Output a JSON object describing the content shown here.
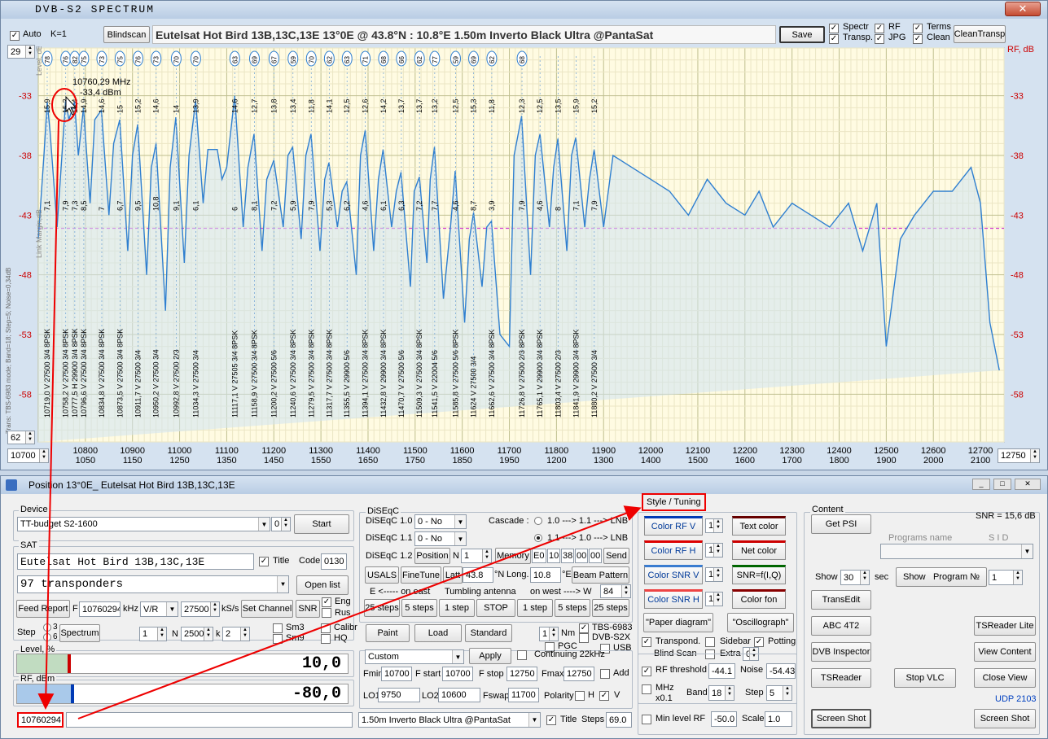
{
  "spectrum": {
    "title": "DVB-S2   SPECTRUM",
    "auto_label": "Auto",
    "k_label": "K=1",
    "blindscan_label": "Blindscan",
    "satellite_info": "Eutelsat Hot Bird 13B,13C,13E    13°0E  @ 43.8°N : 10.8°E     1.50m  Inverto Black Ultra @PantaSat",
    "save_label": "Save",
    "checks": [
      "Spectr",
      "Transp.",
      "RF",
      "JPG",
      "Terms",
      "Clean"
    ],
    "clean_transp_label": "CleanTransp",
    "top_level_value": "29",
    "bottom_level_value": "62",
    "left_freq_value": "10700",
    "right_freq_value": "12750",
    "rf_label": "RF, dB",
    "left_axis_title": "Level, dB",
    "vertical_info": "Trans:  TBS-6983 mode; Band=18; Step=5; Noise=0,34dB",
    "link_margin_label": "Link Margin,dB",
    "cursor_freq": "10760,29 MHz",
    "cursor_level": "-33,4 dBm",
    "y_ticks": [
      "-33",
      "-38",
      "-43",
      "-48",
      "-53",
      "-58"
    ],
    "x_ticks_top": [
      "10800",
      "10900",
      "11000",
      "11100",
      "11200",
      "11300",
      "11400",
      "11500",
      "11600",
      "11700",
      "11800",
      "11900",
      "12000",
      "12100",
      "12200",
      "12300",
      "12400",
      "12500",
      "12600",
      "12700"
    ],
    "x_ticks_bottom": [
      "1050",
      "1150",
      "1250",
      "1350",
      "1450",
      "1550",
      "1650",
      "1750",
      "1850",
      "1950",
      "1200",
      "1300",
      "1400",
      "1500",
      "1600",
      "1700",
      "1800",
      "1900",
      "2000",
      "2100"
    ],
    "circle_labels": [
      "78",
      "76",
      "82",
      "75",
      "73",
      "75",
      "76",
      "73",
      "70",
      "70",
      "63",
      "69",
      "67",
      "59",
      "70",
      "62",
      "63",
      "71",
      "68",
      "66",
      "62",
      "77",
      "59",
      "69",
      "62",
      "68"
    ],
    "snr_labels": [
      "15,9",
      "15,2",
      "16,4",
      "14,9",
      "14,6",
      "15",
      "15,2",
      "14,6",
      "14",
      "13,9",
      "14,6",
      "12,7",
      "13,8",
      "13,4",
      "11,8",
      "14,1",
      "12,5",
      "12,6",
      "14,2",
      "13,7",
      "13,7",
      "13,2",
      "12,5",
      "15,3",
      "11,8",
      "12,3",
      "12,5",
      "13,5"
    ],
    "margin_labels": [
      "7,1",
      "7,9",
      "7,3",
      "8,5",
      "7",
      "6,7",
      "9,5",
      "10,8",
      "9,1",
      "6,1",
      "6",
      "8,1",
      "7,2",
      "5,9",
      "7,9",
      "5,3",
      "6,2",
      "4,6",
      "6,1",
      "6,3",
      "7,2",
      "7,7",
      "4,6",
      "8,7",
      "3,9",
      "7,9",
      "4,6",
      "8"
    ],
    "transponder_labels": [
      "10719,0 V 27500 3/4 8PSK",
      "10758,2 V 27500 3/4 8PSK",
      "10777,5 H 29900 3/4 8PSK",
      "10796,6 V 27500 3/4 8PSK",
      "10834,8 V 27500 3/4 8PSK",
      "10873,5 V 27500 3/4 8PSK",
      "10911,7 V 27500 3/4",
      "10950,2 V 27500 3/4",
      "10992,8 V 27500 2/3",
      "11034,3 V 27500 3/4",
      "11117,1 V 27505 3/4 8PSK",
      "11158,9 V 27500 3/4 8PSK",
      "11200,2 V 27500 5/6",
      "11240,6 V 27500 3/4 8PSK",
      "11279,5 V 27500 3/4 8PSK",
      "11317,7 V 27500 3/4 8PSK",
      "11355,5 V 29900 5/6",
      "11394,1 V 27500 3/4 8PSK",
      "11432,8 V 29900 3/4 8PSK",
      "11470,7 V 27500 5/6",
      "11509,3 V 27500 3/4 8PSK",
      "11541,5 V 22004 5/6",
      "11585,8 V 27500 5/6 8PSK",
      "11624 V 27500 3/4",
      "11662,6 V 27500 3/4 8PSK",
      "11726,8 V 27500 2/3 8PSK",
      "11765,1 V 29900 3/4 8PSK",
      "11803,4 V 27500 2/3",
      "11841,9 V 29900 3/4 8PSK",
      "11880,2 V 27500 3/4"
    ]
  },
  "chart_data": {
    "type": "line",
    "title": "",
    "xlabel": "",
    "ylabel": "Level, dB",
    "xlim": [
      10700,
      12750
    ],
    "ylim": [
      -62,
      -29
    ],
    "threshold": -44.1,
    "x": [
      10700,
      10712,
      10719,
      10725,
      10740,
      10758,
      10765,
      10777,
      10785,
      10796,
      10810,
      10820,
      10834,
      10850,
      10860,
      10873,
      10890,
      10900,
      10911,
      10930,
      10940,
      10950,
      10970,
      10980,
      10992,
      11010,
      11020,
      11034,
      11050,
      11060,
      11080,
      11090,
      11100,
      11117,
      11135,
      11145,
      11158,
      11175,
      11185,
      11200,
      11220,
      11230,
      11240,
      11258,
      11268,
      11279,
      11298,
      11308,
      11317,
      11335,
      11345,
      11355,
      11375,
      11384,
      11394,
      11412,
      11422,
      11432,
      11450,
      11460,
      11470,
      11490,
      11498,
      11509,
      11525,
      11532,
      11541,
      11560,
      11575,
      11585,
      11605,
      11615,
      11624,
      11642,
      11652,
      11662,
      11680,
      11700,
      11710,
      11726,
      11745,
      11755,
      11765,
      11785,
      11794,
      11803,
      11822,
      11832,
      11841,
      11860,
      11870,
      11880,
      11900,
      11920,
      11960,
      12000,
      12040,
      12080,
      12120,
      12160,
      12200,
      12230,
      12260,
      12300,
      12340,
      12380,
      12420,
      12450,
      12480,
      12500,
      12530,
      12560,
      12600,
      12640,
      12680,
      12700,
      12720,
      12740,
      12750
    ],
    "y": [
      -45,
      -38,
      -33.5,
      -36,
      -44,
      -33.4,
      -35,
      -33.5,
      -38,
      -34,
      -42,
      -35,
      -34.2,
      -43,
      -37,
      -35,
      -46,
      -38,
      -35.4,
      -48,
      -39,
      -37,
      -51,
      -39,
      -34.8,
      -47,
      -38,
      -33.4,
      -42,
      -37.5,
      -37.5,
      -40,
      -39,
      -33,
      -44,
      -39,
      -36.2,
      -46,
      -40,
      -38.4,
      -44,
      -38,
      -37.3,
      -45,
      -38,
      -36.2,
      -46,
      -40,
      -38.6,
      -44,
      -41,
      -40.2,
      -48,
      -38,
      -35.9,
      -46,
      -40,
      -37.5,
      -44,
      -41,
      -39.4,
      -49,
      -41,
      -39.8,
      -47,
      -40,
      -37.3,
      -50,
      -44,
      -39.3,
      -52,
      -45,
      -42.8,
      -49,
      -44,
      -43.5,
      -53,
      -54,
      -38,
      -34.7,
      -48,
      -38,
      -36.2,
      -44,
      -39,
      -36.6,
      -46,
      -38,
      -36.5,
      -44,
      -40,
      -37.5,
      -44,
      -38,
      -39,
      -40,
      -41,
      -43,
      -40,
      -42,
      -43,
      -41,
      -44,
      -42,
      -43,
      -44,
      -42,
      -46,
      -42,
      -54,
      -45,
      -43,
      -41,
      -41,
      -39,
      -42,
      -52,
      -56
    ]
  },
  "position": {
    "title": "Position 13°0E_  Eutelsat Hot Bird 13B,13C,13E",
    "device_group": "Device",
    "device_value": "TT-budget S2-1600",
    "device_index": "0",
    "start_label": "Start",
    "sat_group": "SAT",
    "sat_name": "Eutelsat Hot Bird 13B,13C,13E",
    "title_chk": "Title",
    "code_label": "Code",
    "code_value": "0130",
    "transponders_value": "97  transponders",
    "open_list_label": "Open list",
    "feed_report_label": "Feed Report",
    "f_label": "F",
    "freq_value": "10760294",
    "khz_label": "kHz",
    "pol_value": "V/R",
    "sr_value": "27500",
    "ks_label": "kS/s",
    "set_channel_label": "Set Channel",
    "snr_label": "SNR",
    "eng_label": "Eng",
    "rus_label": "Rus",
    "step_label": "Step",
    "step_3": "3",
    "step_6": "6",
    "spectrum_btn": "Spectrum",
    "step_val": "1",
    "n_label": "N",
    "n_value": "2500",
    "k_label": "k",
    "k_value": "2",
    "sm3_label": "Sm3",
    "sm9_label": "Sm9",
    "calibr_label": "Calibr",
    "hq_label": "HQ",
    "level_group": "Level, %",
    "level_value": "10,0",
    "rf_group": "RF, dBm",
    "rf_value": "-80,0",
    "bottom_freq": "10760294",
    "diseqc_group": "DiSEqC",
    "diseqc10": "DiSEqC 1.0",
    "diseqc11": "DiSEqC 1.1",
    "diseqc12": "DiSEqC 1.2",
    "no_value": "0 - No",
    "cascade_label": "Cascade :",
    "cascade1": "1.0 ---> 1.1 ---> LNB",
    "cascade2": "1.1 ---> 1.0 ---> LNB",
    "position_label": "Position",
    "n_short": "N",
    "pos_n_value": "1",
    "memory_label": "Memory",
    "e0_value": "E0",
    "v10": "10",
    "v38": "38",
    "v00a": "00",
    "v00b": "00",
    "send_label": "Send",
    "usals_label": "USALS",
    "finetune_label": "FineTune",
    "latt_label": "Latt",
    "latt_value": "43.8",
    "n_deg": "°N",
    "long_label": "Long.",
    "long_value": "10.8",
    "e_deg": "°E",
    "beam_label": "Beam Pattern",
    "east_label": "E  <-----  on  east",
    "tumbling_label": "Tumbling antenna",
    "west_label": "on  west  ----> W",
    "w_value": "84",
    "step25a": "25 steps",
    "step5a": "5 steps",
    "step1a": "1 step",
    "stop_label": "STOP",
    "step1b": "1 step",
    "step5b": "5 steps",
    "step25b": "25 steps",
    "paint_label": "Paint",
    "load_label": "Load",
    "standard_label": "Standard",
    "nm_value": "1",
    "nm_label": "Nm",
    "pgc_label": "PGC",
    "tbs_label": "TBS-6983",
    "dvbs2x_label": "DVB-S2X",
    "usb_label": "USB",
    "custom_value": "Custom",
    "apply_label": "Apply",
    "continuing_label": "Continuing 22kHz",
    "fmin_label": "Fmin",
    "fmin_value": "10700",
    "fstart_label": "F start",
    "fstart_value": "10700",
    "fstop_label": "F stop",
    "fstop_value": "12750",
    "fmax_label": "Fmax",
    "fmax_value": "12750",
    "add_label": "Add",
    "lo1_label": "LO1",
    "lo1_value": "9750",
    "lo2_label": "LO2",
    "lo2_value": "10600",
    "fswap_label": "Fswap",
    "fswap_value": "11700",
    "polarity_label": "Polarity",
    "h_label": "H",
    "v_label": "V",
    "lnb_value": "1.50m  Inverto Black Ultra @PantaSat",
    "title2_label": "Title",
    "steps_label": "Steps",
    "steps_value": "69.0",
    "style_group": "Style / Tuning",
    "color_rfv": "Color  RF V",
    "color_rfh": "Color  RF H",
    "color_snrv": "Color  SNR V",
    "color_snrh": "Color  SNR H",
    "spin_val": "1",
    "text_color": "Text color",
    "net_color": "Net color",
    "snr_fiq": "SNR=f(I,Q)",
    "color_fon": "Color fon",
    "paper_diagram": "\"Paper diagram\"",
    "oscillograph": "\"Oscillograph\"",
    "transpond_label": "Transpond.",
    "sidebar_label": "Sidebar",
    "potting_label": "Potting",
    "blind_scan_label": "Blind  Scan",
    "extra_label": "Extra",
    "extra_value": "0",
    "rf_threshold_label": "RF threshold",
    "rf_threshold_value": "-44.1",
    "noise_label": "Noise",
    "noise_value": "-54.43",
    "mhz_label": "MHz",
    "x01_label": "x0.1",
    "band_label": "Band",
    "band_value": "18",
    "step2_label": "Step",
    "step2_value": "5",
    "min_level_label": "Min level RF",
    "min_level_value": "-50.0",
    "scale_label": "Scale",
    "scale_value": "1.0",
    "content_group": "Content",
    "snr_db": "SNR = 15,6 dB",
    "get_psi": "Get  PSI",
    "programs_name": "Programs  name",
    "sid_label": "S I D",
    "show_label": "Show",
    "show_value": "30",
    "sec_label": "sec",
    "show_btn": "Show",
    "program_n": "Program  №",
    "program_value": "1",
    "transedit": "TransEdit",
    "abc4t2": "ABC 4T2",
    "tsreader_lite": "TSReader Lite",
    "dvb_inspector": "DVB Inspector",
    "view_content": "View Content",
    "tsreader": "TSReader",
    "stop_vlc": "Stop  VLC",
    "close_view": "Close View",
    "udp": "UDP 2103",
    "screen_shot1": "Screen Shot",
    "screen_shot2": "Screen Shot"
  }
}
